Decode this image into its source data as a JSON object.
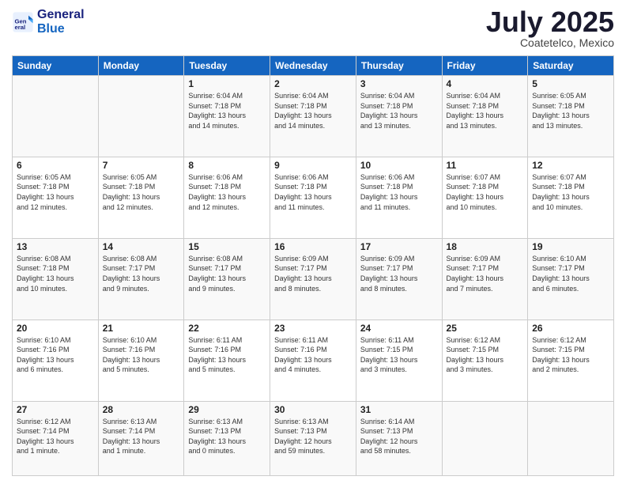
{
  "logo": {
    "line1": "General",
    "line2": "Blue"
  },
  "title": "July 2025",
  "location": "Coatetelco, Mexico",
  "days_of_week": [
    "Sunday",
    "Monday",
    "Tuesday",
    "Wednesday",
    "Thursday",
    "Friday",
    "Saturday"
  ],
  "weeks": [
    [
      {
        "day": "",
        "detail": ""
      },
      {
        "day": "",
        "detail": ""
      },
      {
        "day": "1",
        "detail": "Sunrise: 6:04 AM\nSunset: 7:18 PM\nDaylight: 13 hours\nand 14 minutes."
      },
      {
        "day": "2",
        "detail": "Sunrise: 6:04 AM\nSunset: 7:18 PM\nDaylight: 13 hours\nand 14 minutes."
      },
      {
        "day": "3",
        "detail": "Sunrise: 6:04 AM\nSunset: 7:18 PM\nDaylight: 13 hours\nand 13 minutes."
      },
      {
        "day": "4",
        "detail": "Sunrise: 6:04 AM\nSunset: 7:18 PM\nDaylight: 13 hours\nand 13 minutes."
      },
      {
        "day": "5",
        "detail": "Sunrise: 6:05 AM\nSunset: 7:18 PM\nDaylight: 13 hours\nand 13 minutes."
      }
    ],
    [
      {
        "day": "6",
        "detail": "Sunrise: 6:05 AM\nSunset: 7:18 PM\nDaylight: 13 hours\nand 12 minutes."
      },
      {
        "day": "7",
        "detail": "Sunrise: 6:05 AM\nSunset: 7:18 PM\nDaylight: 13 hours\nand 12 minutes."
      },
      {
        "day": "8",
        "detail": "Sunrise: 6:06 AM\nSunset: 7:18 PM\nDaylight: 13 hours\nand 12 minutes."
      },
      {
        "day": "9",
        "detail": "Sunrise: 6:06 AM\nSunset: 7:18 PM\nDaylight: 13 hours\nand 11 minutes."
      },
      {
        "day": "10",
        "detail": "Sunrise: 6:06 AM\nSunset: 7:18 PM\nDaylight: 13 hours\nand 11 minutes."
      },
      {
        "day": "11",
        "detail": "Sunrise: 6:07 AM\nSunset: 7:18 PM\nDaylight: 13 hours\nand 10 minutes."
      },
      {
        "day": "12",
        "detail": "Sunrise: 6:07 AM\nSunset: 7:18 PM\nDaylight: 13 hours\nand 10 minutes."
      }
    ],
    [
      {
        "day": "13",
        "detail": "Sunrise: 6:08 AM\nSunset: 7:18 PM\nDaylight: 13 hours\nand 10 minutes."
      },
      {
        "day": "14",
        "detail": "Sunrise: 6:08 AM\nSunset: 7:17 PM\nDaylight: 13 hours\nand 9 minutes."
      },
      {
        "day": "15",
        "detail": "Sunrise: 6:08 AM\nSunset: 7:17 PM\nDaylight: 13 hours\nand 9 minutes."
      },
      {
        "day": "16",
        "detail": "Sunrise: 6:09 AM\nSunset: 7:17 PM\nDaylight: 13 hours\nand 8 minutes."
      },
      {
        "day": "17",
        "detail": "Sunrise: 6:09 AM\nSunset: 7:17 PM\nDaylight: 13 hours\nand 8 minutes."
      },
      {
        "day": "18",
        "detail": "Sunrise: 6:09 AM\nSunset: 7:17 PM\nDaylight: 13 hours\nand 7 minutes."
      },
      {
        "day": "19",
        "detail": "Sunrise: 6:10 AM\nSunset: 7:17 PM\nDaylight: 13 hours\nand 6 minutes."
      }
    ],
    [
      {
        "day": "20",
        "detail": "Sunrise: 6:10 AM\nSunset: 7:16 PM\nDaylight: 13 hours\nand 6 minutes."
      },
      {
        "day": "21",
        "detail": "Sunrise: 6:10 AM\nSunset: 7:16 PM\nDaylight: 13 hours\nand 5 minutes."
      },
      {
        "day": "22",
        "detail": "Sunrise: 6:11 AM\nSunset: 7:16 PM\nDaylight: 13 hours\nand 5 minutes."
      },
      {
        "day": "23",
        "detail": "Sunrise: 6:11 AM\nSunset: 7:16 PM\nDaylight: 13 hours\nand 4 minutes."
      },
      {
        "day": "24",
        "detail": "Sunrise: 6:11 AM\nSunset: 7:15 PM\nDaylight: 13 hours\nand 3 minutes."
      },
      {
        "day": "25",
        "detail": "Sunrise: 6:12 AM\nSunset: 7:15 PM\nDaylight: 13 hours\nand 3 minutes."
      },
      {
        "day": "26",
        "detail": "Sunrise: 6:12 AM\nSunset: 7:15 PM\nDaylight: 13 hours\nand 2 minutes."
      }
    ],
    [
      {
        "day": "27",
        "detail": "Sunrise: 6:12 AM\nSunset: 7:14 PM\nDaylight: 13 hours\nand 1 minute."
      },
      {
        "day": "28",
        "detail": "Sunrise: 6:13 AM\nSunset: 7:14 PM\nDaylight: 13 hours\nand 1 minute."
      },
      {
        "day": "29",
        "detail": "Sunrise: 6:13 AM\nSunset: 7:13 PM\nDaylight: 13 hours\nand 0 minutes."
      },
      {
        "day": "30",
        "detail": "Sunrise: 6:13 AM\nSunset: 7:13 PM\nDaylight: 12 hours\nand 59 minutes."
      },
      {
        "day": "31",
        "detail": "Sunrise: 6:14 AM\nSunset: 7:13 PM\nDaylight: 12 hours\nand 58 minutes."
      },
      {
        "day": "",
        "detail": ""
      },
      {
        "day": "",
        "detail": ""
      }
    ]
  ]
}
